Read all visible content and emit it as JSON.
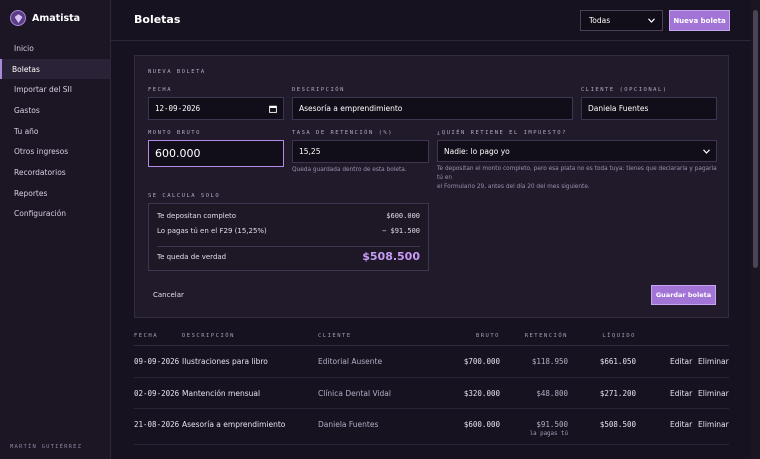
{
  "app": {
    "name": "Amatista"
  },
  "sidebar": {
    "items": [
      {
        "label": "Inicio"
      },
      {
        "label": "Boletas",
        "active": true
      },
      {
        "label": "Importar del SII"
      },
      {
        "label": "Gastos"
      },
      {
        "label": "Tu año"
      },
      {
        "label": "Otros ingresos"
      },
      {
        "label": "Recordatorios"
      },
      {
        "label": "Reportes"
      },
      {
        "label": "Configuración"
      }
    ],
    "footer_user": "MARTÍN GUTIÉRREZ"
  },
  "header": {
    "title": "Boletas",
    "filter_value": "Todas",
    "new_button": "Nueva boleta"
  },
  "form": {
    "heading": "NUEVA BOLETA",
    "fecha_label": "FECHA",
    "fecha_value": "12-09-2026",
    "descripcion_label": "DESCRIPCIÓN",
    "descripcion_value": "Asesoría a emprendimiento",
    "cliente_label": "CLIENTE (OPCIONAL)",
    "cliente_value": "Daniela Fuentes",
    "monto_label": "MONTO BRUTO",
    "monto_value": "600.000",
    "tasa_label": "TASA DE RETENCIÓN (%)",
    "tasa_value": "15,25",
    "tasa_hint": "Queda guardada dentro de esta boleta.",
    "retiene_label": "¿QUIÉN RETIENE EL IMPUESTO?",
    "retiene_value": "Nadie: lo pago yo",
    "retiene_hint_1": "Te depositan el monto completo, pero esa plata no es toda tuya: tienes que declararla y pagarla tú en",
    "retiene_hint_2": "el Formulario 29, antes del día 20 del mes siguiente.",
    "calc_heading": "SE CALCULA SOLO",
    "calc": {
      "depositan_label": "Te depositan completo",
      "depositan_value": "$600.000",
      "pagas_label": "Lo pagas tú en el F29 (15,25%)",
      "pagas_value": "− $91.500",
      "queda_label": "Te queda de verdad",
      "queda_value": "$508.500"
    },
    "cancel": "Cancelar",
    "save": "Guardar boleta"
  },
  "table": {
    "headers": {
      "fecha": "FECHA",
      "descripcion": "DESCRIPCIÓN",
      "cliente": "CLIENTE",
      "bruto": "BRUTO",
      "retencion": "RETENCIÓN",
      "liquido": "LÍQUIDO"
    },
    "edit_label": "Editar",
    "delete_label": "Eliminar",
    "rows": [
      {
        "fecha": "09-09-2026",
        "descripcion": "Ilustraciones para libro",
        "cliente": "Editorial Ausente",
        "bruto": "$700.000",
        "retencion": "$118.950",
        "liquido": "$661.050",
        "retencion_note": ""
      },
      {
        "fecha": "02-09-2026",
        "descripcion": "Mantención mensual",
        "cliente": "Clínica Dental Vidal",
        "bruto": "$320.000",
        "retencion": "$48.800",
        "liquido": "$271.200",
        "retencion_note": ""
      },
      {
        "fecha": "21-08-2026",
        "descripcion": "Asesoría a emprendimiento",
        "cliente": "Daniela Fuentes",
        "bruto": "$600.000",
        "retencion": "$91.500",
        "liquido": "$508.500",
        "retencion_note": "la pagas tú"
      }
    ]
  }
}
